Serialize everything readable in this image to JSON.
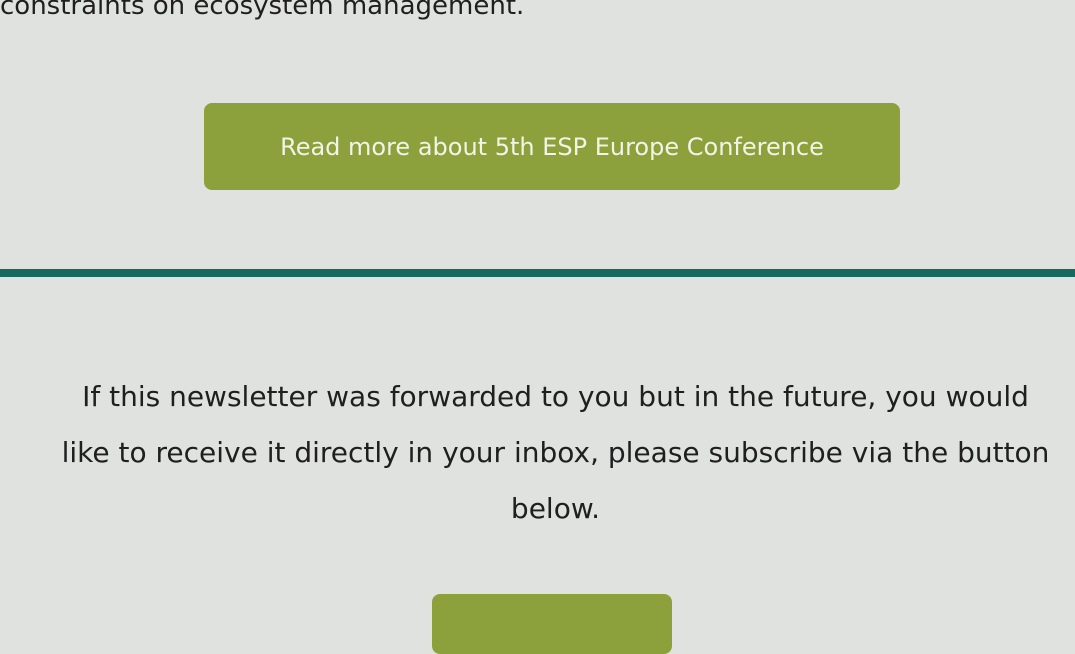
{
  "article": {
    "last_line": "constraints on ecosystem management."
  },
  "read_more_button": {
    "label": "Read more about 5th ESP Europe Conference"
  },
  "subscribe_section": {
    "line1": "If this newsletter was forwarded to you but in the future, you would",
    "line2": "like to receive it directly in your inbox, please subscribe via the button",
    "line3": "below."
  },
  "colors": {
    "background": "#e0e2df",
    "button": "#8ca13c",
    "divider": "#17695d"
  }
}
